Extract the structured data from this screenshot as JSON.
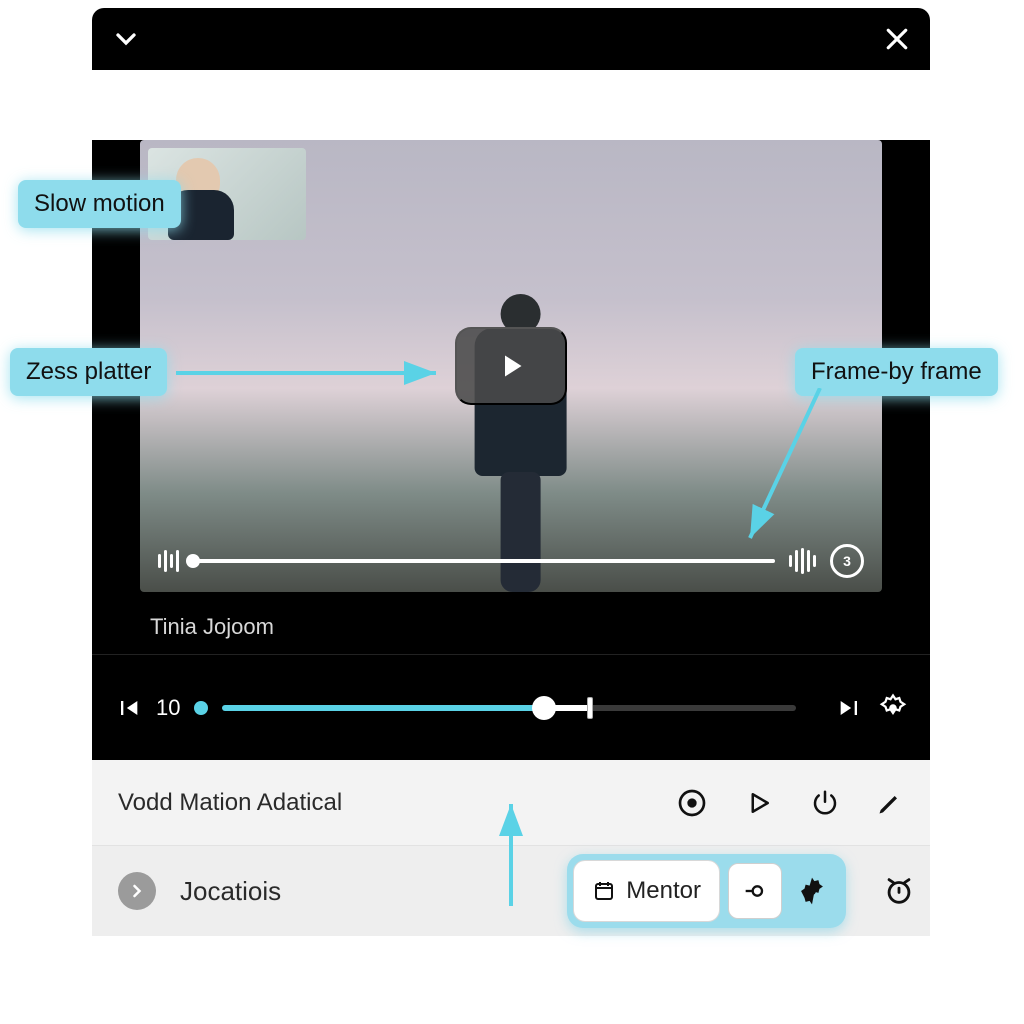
{
  "annotations": {
    "slow_motion": "Slow motion",
    "zess_platter": "Zess platter",
    "frame_by_frame": "Frame-by frame"
  },
  "video": {
    "title": "Tinia Jojoom",
    "replay_badge": "3"
  },
  "controls": {
    "speed_value": "10"
  },
  "strip1": {
    "label": "Vodd Mation Adatical"
  },
  "strip2": {
    "label": "Jocatiois",
    "mentor_label": "Mentor"
  },
  "colors": {
    "accent": "#8edcec"
  }
}
